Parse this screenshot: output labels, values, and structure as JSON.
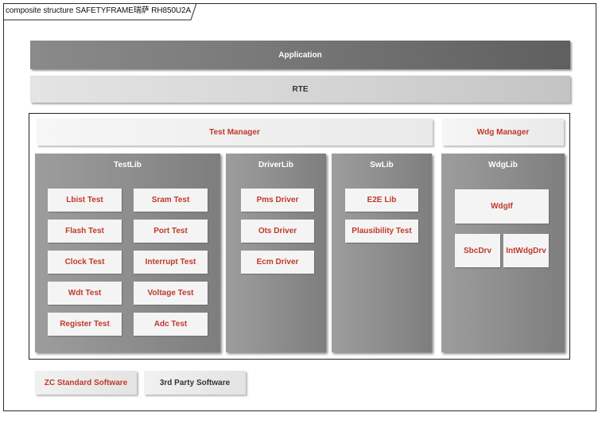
{
  "frame": {
    "title": "composite structure SAFETYFRAME瑞萨 RH850U2A"
  },
  "layers": {
    "application": "Application",
    "rte": "RTE"
  },
  "managers": {
    "test_manager": "Test Manager",
    "wdg_manager": "Wdg Manager"
  },
  "libs": {
    "testlib": {
      "title": "TestLib",
      "items": [
        "Lbist Test",
        "Sram Test",
        "Flash Test",
        "Port Test",
        "Clock Test",
        "Interrupt Test",
        "Wdt Test",
        "Voltage Test",
        "Register Test",
        "Adc Test"
      ]
    },
    "driverlib": {
      "title": "DriverLib",
      "items": [
        "Pms Driver",
        "Ots Driver",
        "Ecm Driver"
      ]
    },
    "swlib": {
      "title": "SwLib",
      "items": [
        "E2E Lib",
        "Plausibility Test"
      ]
    },
    "wdglib": {
      "title": "WdgLib",
      "items": [
        "WdgIf",
        "SbcDrv",
        "IntWdgDrv"
      ]
    }
  },
  "legend": {
    "zc_standard": "ZC Standard Software",
    "third_party": "3rd Party Software"
  },
  "colors": {
    "accent_text": "#c0392b",
    "dark_bar": "#6f6f6f",
    "light_bar": "#d3d3d3"
  }
}
